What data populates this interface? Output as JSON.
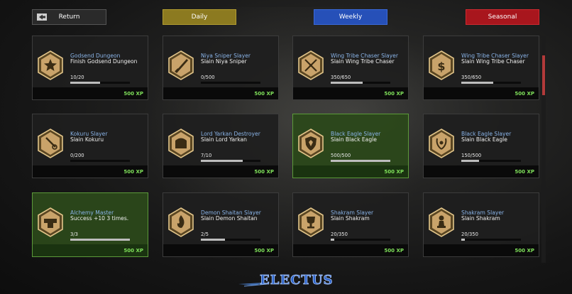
{
  "nav": {
    "return_label": "Return",
    "daily_label": "Daily",
    "weekly_label": "Weekly",
    "seasonal_label": "Seasonal"
  },
  "colors": {
    "daily": "#8c7a20",
    "weekly": "#2650b8",
    "seasonal": "#a8161d",
    "completed_card": "#2b481a",
    "xp_text": "#7fe05a",
    "quest_title": "#8ab4e8"
  },
  "cards": [
    {
      "title": "Godsend Dungeon",
      "desc": "Finish Godsend Dungeon",
      "progress": "10/20",
      "fraction": 0.5,
      "xp": "500 XP",
      "icon": "star-icon",
      "completed": false
    },
    {
      "title": "Niya Sniper Slayer",
      "desc": "Slain Niya Sniper",
      "progress": "0/500",
      "fraction": 0,
      "xp": "500 XP",
      "icon": "sword-icon",
      "completed": false
    },
    {
      "title": "Wing Tribe Chaser Slayer",
      "desc": "Slain Wing Tribe Chaser",
      "progress": "350/650",
      "fraction": 0.54,
      "xp": "500 XP",
      "icon": "crossed-swords-icon",
      "completed": false
    },
    {
      "title": "Wing Tribe Chaser Slayer",
      "desc": "Slain Wing Tribe Chaser",
      "progress": "350/650",
      "fraction": 0.54,
      "xp": "500 XP",
      "icon": "dollar-icon",
      "completed": false
    },
    {
      "title": "Kokuru Slayer",
      "desc": "Slain Kokuru",
      "progress": "0/200",
      "fraction": 0,
      "xp": "500 XP",
      "icon": "wrench-icon",
      "completed": false
    },
    {
      "title": "Lord Yarkan Destroyer",
      "desc": "Slain Lord Yarkan",
      "progress": "7/10",
      "fraction": 0.7,
      "xp": "500 XP",
      "icon": "chest-icon",
      "completed": false
    },
    {
      "title": "Black Eagle Slayer",
      "desc": "Slain Black Eagle",
      "progress": "500/500",
      "fraction": 1,
      "xp": "500 XP",
      "icon": "shield-icon",
      "completed": true
    },
    {
      "title": "Black Eagle Slayer",
      "desc": "Slain Black Eagle",
      "progress": "150/500",
      "fraction": 0.3,
      "xp": "500 XP",
      "icon": "laurel-icon",
      "completed": false
    },
    {
      "title": "Alchemy Master",
      "desc": "Success +10  3 times.",
      "progress": "3/3",
      "fraction": 1,
      "xp": "500 XP",
      "icon": "anvil-icon",
      "completed": true
    },
    {
      "title": "Demon Shaitan Slayer",
      "desc": "Slain Demon Shaitan",
      "progress": "2/5",
      "fraction": 0.4,
      "xp": "500 XP",
      "icon": "flame-icon",
      "completed": false
    },
    {
      "title": "Shakram Slayer",
      "desc": "Slain Shakram",
      "progress": "20/350",
      "fraction": 0.057,
      "xp": "500 XP",
      "icon": "trophy-icon",
      "completed": false
    },
    {
      "title": "Shakram Slayer",
      "desc": "Slain Shakram",
      "progress": "20/350",
      "fraction": 0.057,
      "xp": "500 XP",
      "icon": "chess-pawn-icon",
      "completed": false
    }
  ],
  "logo_text": "ELECTUS"
}
